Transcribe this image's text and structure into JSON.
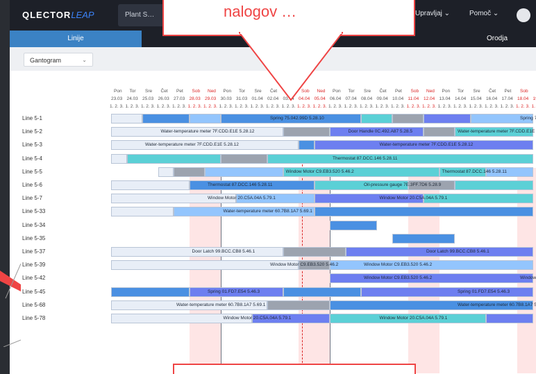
{
  "app": {
    "logo_main": "QLECTOR",
    "logo_accent": "LEAP",
    "plant_tab": "Plant S…",
    "menu_manage": "Upravljaj",
    "menu_help": "Pomoč"
  },
  "subtabs": {
    "lines": "Linije",
    "tools": "Orodja"
  },
  "filter": {
    "view_select": "Gantogram"
  },
  "callout_text": "nalogov …",
  "days": [
    "Pon",
    "Tor",
    "Sre",
    "Čet",
    "Pet",
    "Sob",
    "Ned",
    "Pon",
    "Tor",
    "Sre",
    "Čet",
    "Pet",
    "Sob",
    "Ned",
    "Pon",
    "Tor",
    "Sre",
    "Čet",
    "Pet",
    "Sob",
    "Ned",
    "Pon",
    "Tor",
    "Sre",
    "Čet",
    "Pet",
    "Sob",
    "Ned"
  ],
  "dates": [
    "23.03",
    "24.03",
    "25.03",
    "26.03",
    "27.03",
    "28.03",
    "29.03",
    "30.03",
    "31.03",
    "01.04",
    "02.04",
    "03.04",
    "04.04",
    "05.04",
    "06.04",
    "07.04",
    "08.04",
    "09.04",
    "10.04",
    "11.04",
    "12.04",
    "13.04",
    "14.04",
    "15.04",
    "16.04",
    "17.04",
    "18.04",
    "19.04"
  ],
  "shift": "1. 2. 3.",
  "rows": [
    "Line 5-1",
    "Line 5-2",
    "Line 5-3",
    "Line 5-4",
    "Line 5-5",
    "Line 5-6",
    "Line 5-7",
    "Line 5-33",
    "Line 5-34",
    "Line 5-35",
    "Line 5-37",
    "Line 5-39",
    "Line 5-42",
    "Line 5-45",
    "Line 5-68",
    "Line 5-78"
  ],
  "bar_labels": {
    "r1a": "Spring 75.042.99D 5.28.10",
    "r1b": "Spring 75.04",
    "r2a": "Water-temperature meter 7F.CDD.E1E 5.28.12",
    "r2b": "Door Handle 0C.492.A87 5.28.5",
    "r2c": "Water-temperature meter 7F.CDD.E1E 5.28.",
    "r3a": "Water-temperature meter 7F.CDD.E1E 5.28.12",
    "r3b": "Water-temperature meter 7F.CDD.E1E 5.28.12",
    "r4a": "Thermostat 87.DCC.146 5.28.11",
    "r5a": "Window Motor C9.EB3.520 5.46.2",
    "r5b": "Thermostat 87.DCC.146 5.28.11",
    "r6a": "Thermostat 87.DCC.146 5.28.11",
    "r6b": "Oil-pressure gauge 7E.3FF.7D6 5.28.9",
    "r7a": "Window Motor 20.C5A.04A 5.79.1",
    "r7b": "Window Motor 20.C5A.04A 5.79.1",
    "r33a": "Water-temperature meter 60.7B8.1A7 5.69.1",
    "r37a": "Door Latch 99.BCC.CB8 5.46.1",
    "r37b": "Door Latch 99.BCC.CB8 5.46.1",
    "r39a": "Window Motor C9.EB3.520 5.46.2",
    "r39b": "Window Motor C9.EB3.520 5.46.2",
    "r42a": "Window Motor C9.EB3.520 5.46.2",
    "r42b": "Window Motor",
    "r45a": "Spring 01.FD7.E54 5.46.3",
    "r45b": "Spring 01.FD7.E54 5.46.3",
    "r68a": "Water-temperature meter 60.7B8.1A7 5.69.1",
    "r68b": "Water-temperature meter 60.7B8.1A7 5.",
    "r78a": "Window Motor 20.C5A.04A 5.79.1",
    "r78b": "Window Motor 20.C5A.04A 5.79.1"
  },
  "colors": {
    "blue": "#4a90e2",
    "lightblue": "#93c5fd",
    "teal": "#5bd0d6",
    "indigo": "#6d7ff0",
    "gray": "#9ca3af",
    "pale": "#e8eef7"
  }
}
